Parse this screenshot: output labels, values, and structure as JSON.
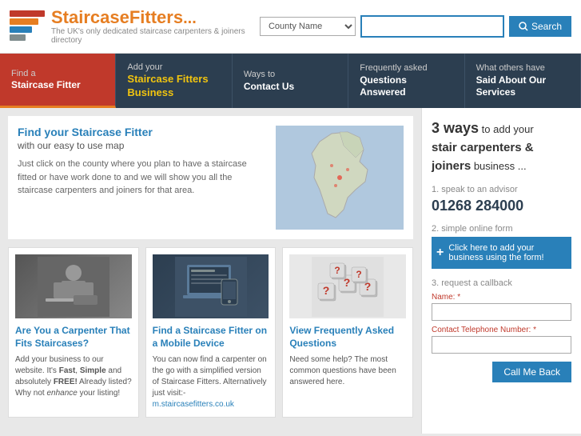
{
  "header": {
    "logo_title": "StaircaseFitters",
    "logo_dots": "...",
    "logo_subtitle": "The UK's only dedicated staircase carpenters & joiners directory",
    "search": {
      "county_placeholder": "County Name",
      "search_placeholder": "",
      "search_label": "Search"
    }
  },
  "nav": {
    "items": [
      {
        "id": "find",
        "line1": "Find a",
        "line2": "Staircase Fitter",
        "active": true
      },
      {
        "id": "add",
        "line1": "Add your",
        "line2": "Staircase Fitters Business",
        "active": false
      },
      {
        "id": "contact",
        "line1": "Ways to",
        "line2": "Contact Us",
        "active": false
      },
      {
        "id": "faq",
        "line1": "Frequently asked",
        "line2": "Questions Answered",
        "active": false
      },
      {
        "id": "testimonials",
        "line1": "What others have",
        "line2": "Said About Our Services",
        "active": false
      }
    ]
  },
  "map_section": {
    "title": "Find your Staircase Fitter",
    "subtitle": "with our easy to use map",
    "body": "Just click on the county where you plan to have a staircase fitted or have work done to and we will show you all the staircase carpenters and joiners for that area."
  },
  "cards": [
    {
      "id": "carpenter",
      "title": "Are You a Carpenter That Fits Staircases?",
      "body_parts": [
        {
          "text": "Add your business to our website. It's ",
          "type": "normal"
        },
        {
          "text": "Fast",
          "type": "bold"
        },
        {
          "text": ", ",
          "type": "normal"
        },
        {
          "text": "Simple",
          "type": "bold"
        },
        {
          "text": " and absolutely ",
          "type": "normal"
        },
        {
          "text": "FREE!",
          "type": "bold"
        },
        {
          "text": " Already listed? Why not ",
          "type": "normal"
        },
        {
          "text": "enhance",
          "type": "italic"
        },
        {
          "text": " your listing!",
          "type": "normal"
        }
      ]
    },
    {
      "id": "mobile",
      "title": "Find a Staircase Fitter on a Mobile Device",
      "body_parts": [
        {
          "text": "You can now find a carpenter on the go with a simplified version of Staircase Fitters.",
          "type": "normal"
        },
        {
          "text": " Alternatively just visit:- m.staircasefitters.co.uk",
          "type": "link"
        }
      ]
    },
    {
      "id": "faq",
      "title": "View Frequently Asked Questions",
      "body_parts": [
        {
          "text": "Need some help? The most common questions have been answered here.",
          "type": "normal"
        }
      ]
    }
  ],
  "right_panel": {
    "headline_ways": "3 ways",
    "headline_rest": " to add your",
    "headline2": "stair carpenters &",
    "headline3": "joiners",
    "headline4": " business ...",
    "step1_label": "1. speak to an advisor",
    "phone": "01268 284000",
    "step2_label": "2. simple online form",
    "form_btn": "Click here to add your business using the form!",
    "step3_label": "3. request a callback",
    "name_label": "Name:",
    "name_required": "*",
    "phone_label": "Contact Telephone Number:",
    "phone_required": "*",
    "call_btn": "Call Me Back"
  }
}
